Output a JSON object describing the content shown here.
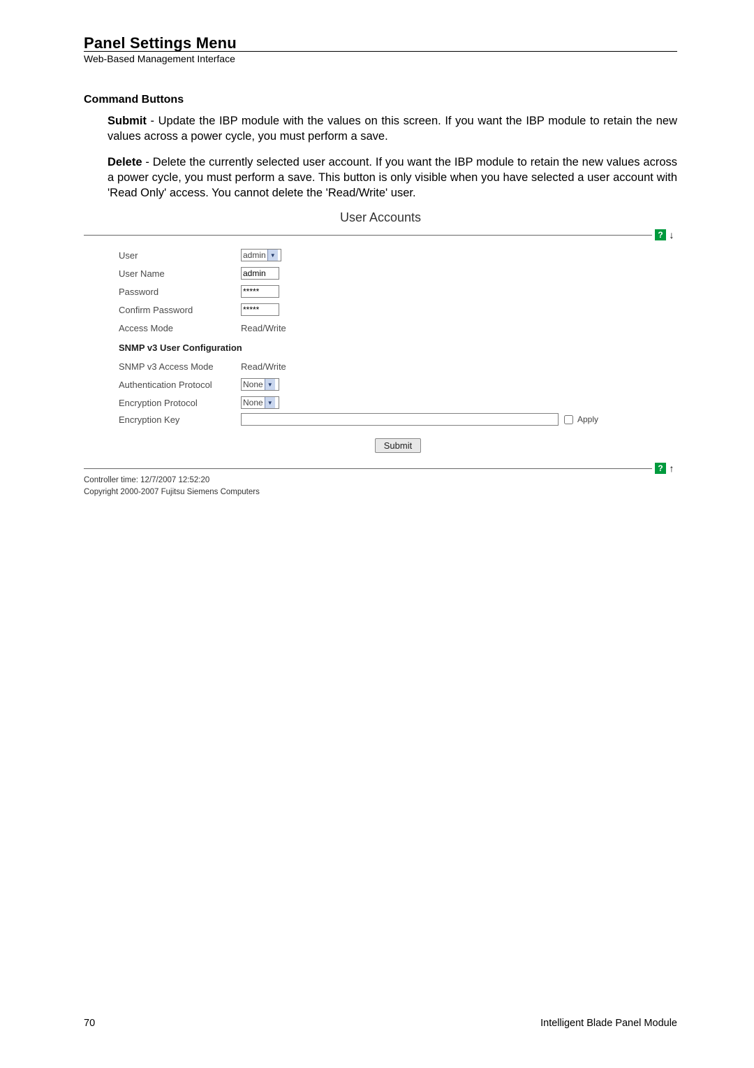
{
  "header": {
    "title": "Panel Settings Menu",
    "subtitle": "Web-Based Management Interface"
  },
  "section": {
    "heading": "Command Buttons",
    "submit_term": "Submit",
    "submit_desc": " - Update the IBP module with the values on this screen. If you want the IBP module to retain the new values across a power cycle, you must perform a save.",
    "delete_term": "Delete",
    "delete_desc": " - Delete the currently selected user account. If you want the IBP module to retain the new values across a power cycle, you must perform a save. This button is only visible when you have selected a user account with 'Read Only' access. You cannot delete the 'Read/Write' user."
  },
  "shot": {
    "title": "User Accounts",
    "help_glyph": "?",
    "down_glyph": "↓",
    "up_glyph": "↑",
    "labels": {
      "user": "User",
      "user_name": "User Name",
      "password": "Password",
      "confirm_password": "Confirm Password",
      "access_mode": "Access Mode",
      "snmp_heading": "SNMP v3 User Configuration",
      "snmp_access": "SNMP v3 Access Mode",
      "auth_proto": "Authentication Protocol",
      "enc_proto": "Encryption Protocol",
      "enc_key": "Encryption Key",
      "apply": "Apply",
      "submit": "Submit"
    },
    "values": {
      "user_select": "admin",
      "user_name": "admin",
      "password": "*****",
      "confirm_password": "*****",
      "access_mode": "Read/Write",
      "snmp_access": "Read/Write",
      "auth_proto": "None",
      "enc_proto": "None",
      "enc_key": ""
    },
    "footer1": "Controller time: 12/7/2007 12:52:20",
    "footer2": "Copyright 2000-2007 Fujitsu Siemens Computers"
  },
  "page": {
    "number": "70",
    "product": "Intelligent Blade Panel Module"
  }
}
